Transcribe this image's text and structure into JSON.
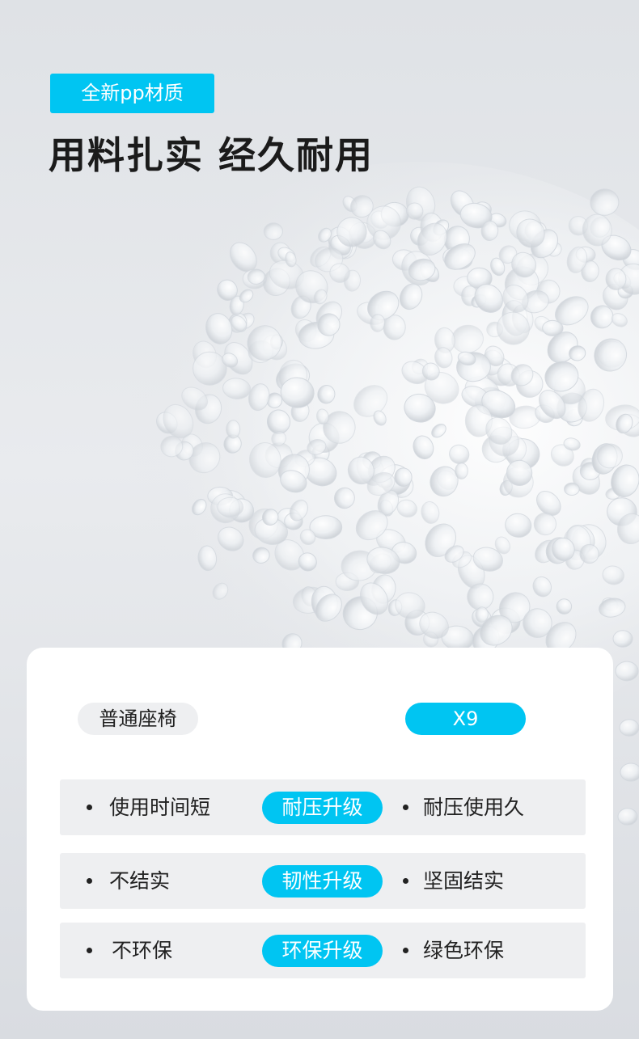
{
  "header": {
    "tag_label": "全新pp材质",
    "headline": "用料扎实 经久耐用"
  },
  "comparison": {
    "left_label": "普通座椅",
    "right_label": "X9",
    "rows": [
      {
        "left": "使用时间短",
        "badge": "耐压升级",
        "right": "耐压使用久"
      },
      {
        "left": "不结实",
        "badge": "韧性升级",
        "right": "坚固结实"
      },
      {
        "left": "不环保",
        "badge": "环保升级",
        "right": "绿色环保"
      }
    ]
  },
  "colors": {
    "accent": "#00c5f2",
    "background": "#e5e7ea",
    "card": "#ffffff",
    "row_bg": "#eeeff1",
    "text_dark": "#1b1b1b"
  },
  "image": {
    "subject": "pp-pellets"
  }
}
